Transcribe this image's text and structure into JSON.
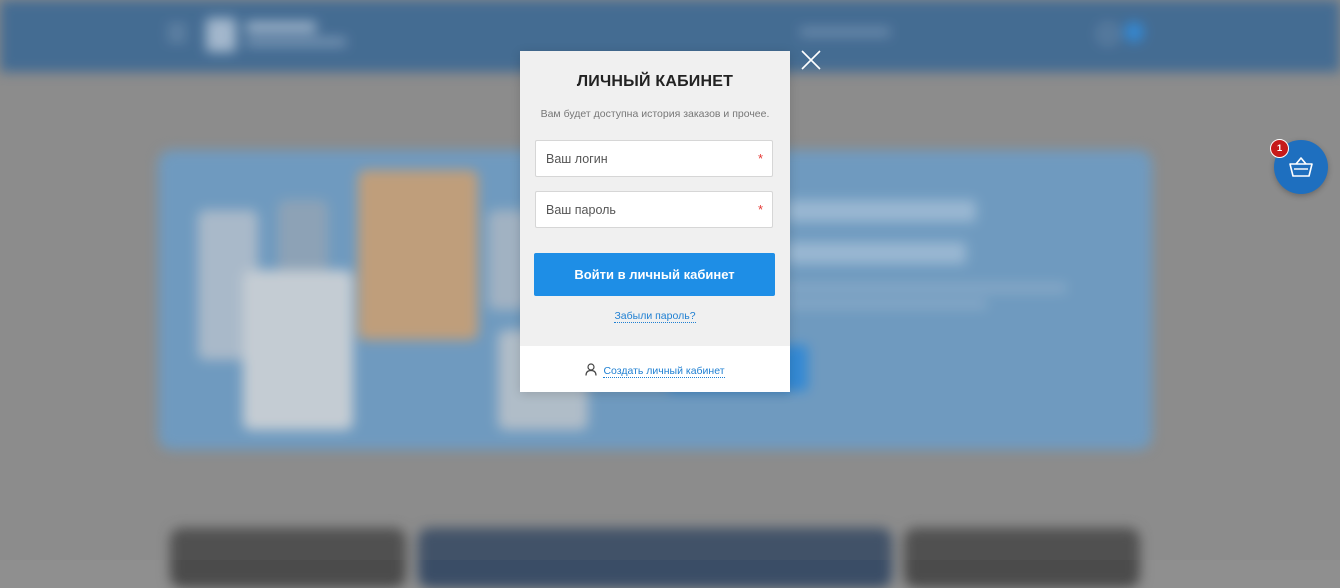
{
  "modal": {
    "title": "ЛИЧНЫЙ КАБИНЕТ",
    "subtitle": "Вам будет доступна история заказов и прочее.",
    "login_placeholder": "Ваш логин",
    "password_placeholder": "Ваш пароль",
    "required_mark": "*",
    "login_button": "Войти в личный кабинет",
    "forgot_link": "Забыли пароль?",
    "register_link": "Создать личный кабинет"
  },
  "cart": {
    "count": "1"
  },
  "colors": {
    "accent": "#1e8ee6",
    "link": "#1e7fd2",
    "badge": "#c61a1a",
    "header": "#3d6a96"
  },
  "icons": {
    "close": "close-icon",
    "user": "user-icon",
    "cart": "basket-icon"
  }
}
